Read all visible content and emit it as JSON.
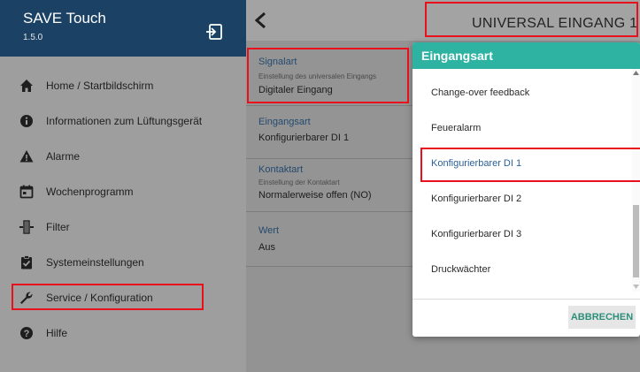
{
  "app": {
    "title": "SAVE Touch",
    "version": "1.5.0"
  },
  "sidebar": {
    "items": [
      {
        "label": "Home / Startbildschirm",
        "icon": "home-icon"
      },
      {
        "label": "Informationen zum Lüftungsgerät",
        "icon": "info-icon"
      },
      {
        "label": "Alarme",
        "icon": "warning-icon"
      },
      {
        "label": "Wochenprogramm",
        "icon": "calendar-icon"
      },
      {
        "label": "Filter",
        "icon": "filter-icon"
      },
      {
        "label": "Systemeinstellungen",
        "icon": "clipboard-check-icon"
      },
      {
        "label": "Service / Konfiguration",
        "icon": "wrench-icon"
      },
      {
        "label": "Hilfe",
        "icon": "help-icon"
      }
    ]
  },
  "header": {
    "title": "UNIVERSAL EINGANG 1"
  },
  "settings": [
    {
      "label": "Signalart",
      "desc": "Einstellung des universalen Eingangs",
      "value": "Digitaler Eingang"
    },
    {
      "label": "Eingangsart",
      "desc": "",
      "value": "Konfigurierbarer DI 1"
    },
    {
      "label": "Kontaktart",
      "desc": "Einstellung der Kontaktart",
      "value": "Normalerweise offen (NO)"
    },
    {
      "label": "Wert",
      "desc": "",
      "value": "Aus"
    }
  ],
  "dialog": {
    "title": "Eingangsart",
    "options": [
      "Change-over feedback",
      "Feueralarm",
      "Konfigurierbarer DI 1",
      "Konfigurierbarer DI 2",
      "Konfigurierbarer DI 3",
      "Druckwächter"
    ],
    "selected": "Konfigurierbarer DI 1",
    "cancel_label": "ABBRECHEN"
  },
  "colors": {
    "sidebar_header": "#1b4265",
    "dialog_header": "#2eb3a2",
    "highlight": "#e8101a",
    "selected_text": "#2b5f97"
  }
}
